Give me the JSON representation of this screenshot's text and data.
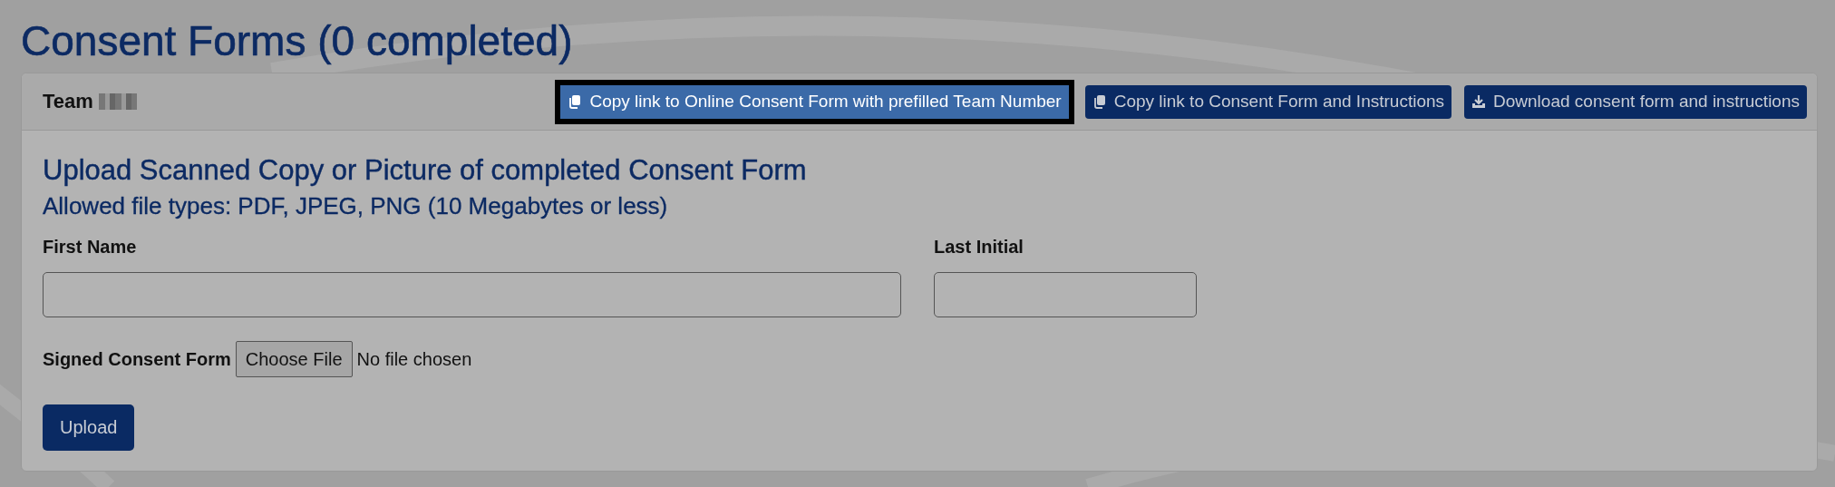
{
  "page_title": "Consent Forms (0 completed)",
  "card": {
    "team_label": "Team",
    "buttons": [
      {
        "label": "Copy link to Online Consent Form with prefilled Team Number",
        "kind": "copy",
        "focused": true
      },
      {
        "label": "Copy link to Consent Form and Instructions",
        "kind": "copy",
        "focused": false
      },
      {
        "label": "Download consent form and instructions",
        "kind": "download",
        "focused": false
      }
    ],
    "heading": "Upload Scanned Copy or Picture of completed Consent Form",
    "subheading": "Allowed file types: PDF, JPEG, PNG (10 Megabytes or less)",
    "fields": [
      {
        "label": "First Name"
      },
      {
        "label": "Last Initial"
      }
    ],
    "file_label": "Signed Consent Form",
    "file_button": "Choose File",
    "file_status": "No file chosen",
    "submit": "Upload"
  }
}
